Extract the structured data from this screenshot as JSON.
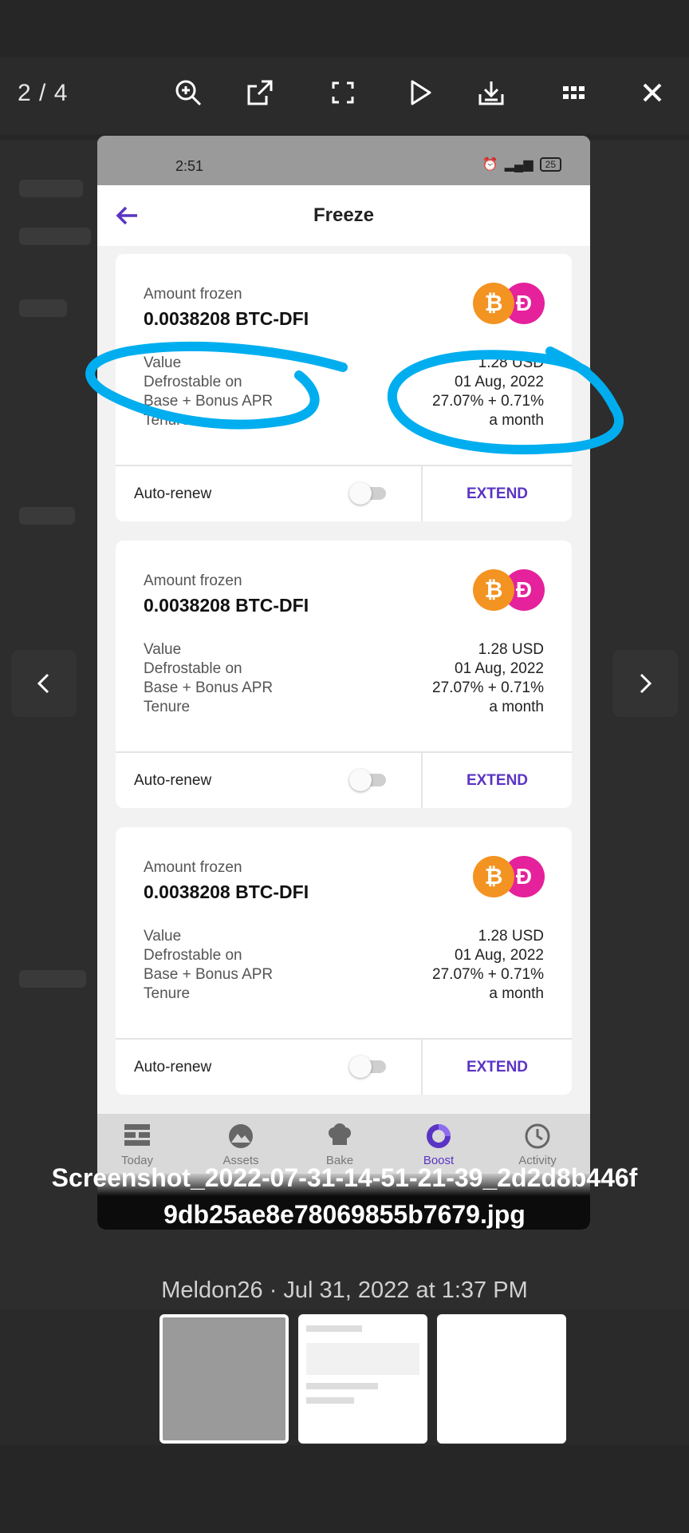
{
  "viewer": {
    "counter": "2 / 4",
    "toolbar_icons": [
      "zoom-in-icon",
      "open-external-icon",
      "fullscreen-icon",
      "play-icon",
      "download-icon",
      "grid-icon",
      "close-icon"
    ]
  },
  "phone": {
    "status_time": "2:51",
    "battery": "25",
    "screen_title": "Freeze",
    "cards": [
      {
        "amount_label": "Amount frozen",
        "amount": "0.0038208 BTC-DFI",
        "rows": [
          {
            "label": "Value",
            "value": "1.28 USD"
          },
          {
            "label": "Defrostable on",
            "value": "01 Aug, 2022"
          },
          {
            "label": "Base + Bonus APR",
            "value": "27.07% + 0.71%"
          },
          {
            "label": "Tenure",
            "value": "a month"
          }
        ],
        "auto_renew_label": "Auto-renew",
        "extend_label": "EXTEND"
      },
      {
        "amount_label": "Amount frozen",
        "amount": "0.0038208 BTC-DFI",
        "rows": [
          {
            "label": "Value",
            "value": "1.28 USD"
          },
          {
            "label": "Defrostable on",
            "value": "01 Aug, 2022"
          },
          {
            "label": "Base + Bonus APR",
            "value": "27.07% + 0.71%"
          },
          {
            "label": "Tenure",
            "value": "a month"
          }
        ],
        "auto_renew_label": "Auto-renew",
        "extend_label": "EXTEND"
      },
      {
        "amount_label": "Amount frozen",
        "amount": "0.0038208 BTC-DFI",
        "rows": [
          {
            "label": "Value",
            "value": "1.28 USD"
          },
          {
            "label": "Defrostable on",
            "value": "01 Aug, 2022"
          },
          {
            "label": "Base + Bonus APR",
            "value": "27.07% + 0.71%"
          },
          {
            "label": "Tenure",
            "value": "a month"
          }
        ],
        "auto_renew_label": "Auto-renew",
        "extend_label": "EXTEND"
      }
    ],
    "nav": [
      {
        "label": "Today",
        "icon": "bricks-icon"
      },
      {
        "label": "Assets",
        "icon": "mountain-icon"
      },
      {
        "label": "Bake",
        "icon": "chef-hat-icon"
      },
      {
        "label": "Boost",
        "icon": "boost-icon"
      },
      {
        "label": "Activity",
        "icon": "clock-icon"
      }
    ]
  },
  "caption": {
    "filename": "Screenshot_2022-07-31-14-51-21-39_2d2d8b446f9db25ae8e78069855b7679.jpg",
    "meta": "Meldon26 · Jul 31, 2022 at 1:37 PM"
  },
  "colors": {
    "accent": "#5a34c4",
    "annotation": "#00aeef",
    "btc": "#f39321",
    "dfi": "#e5219b"
  }
}
